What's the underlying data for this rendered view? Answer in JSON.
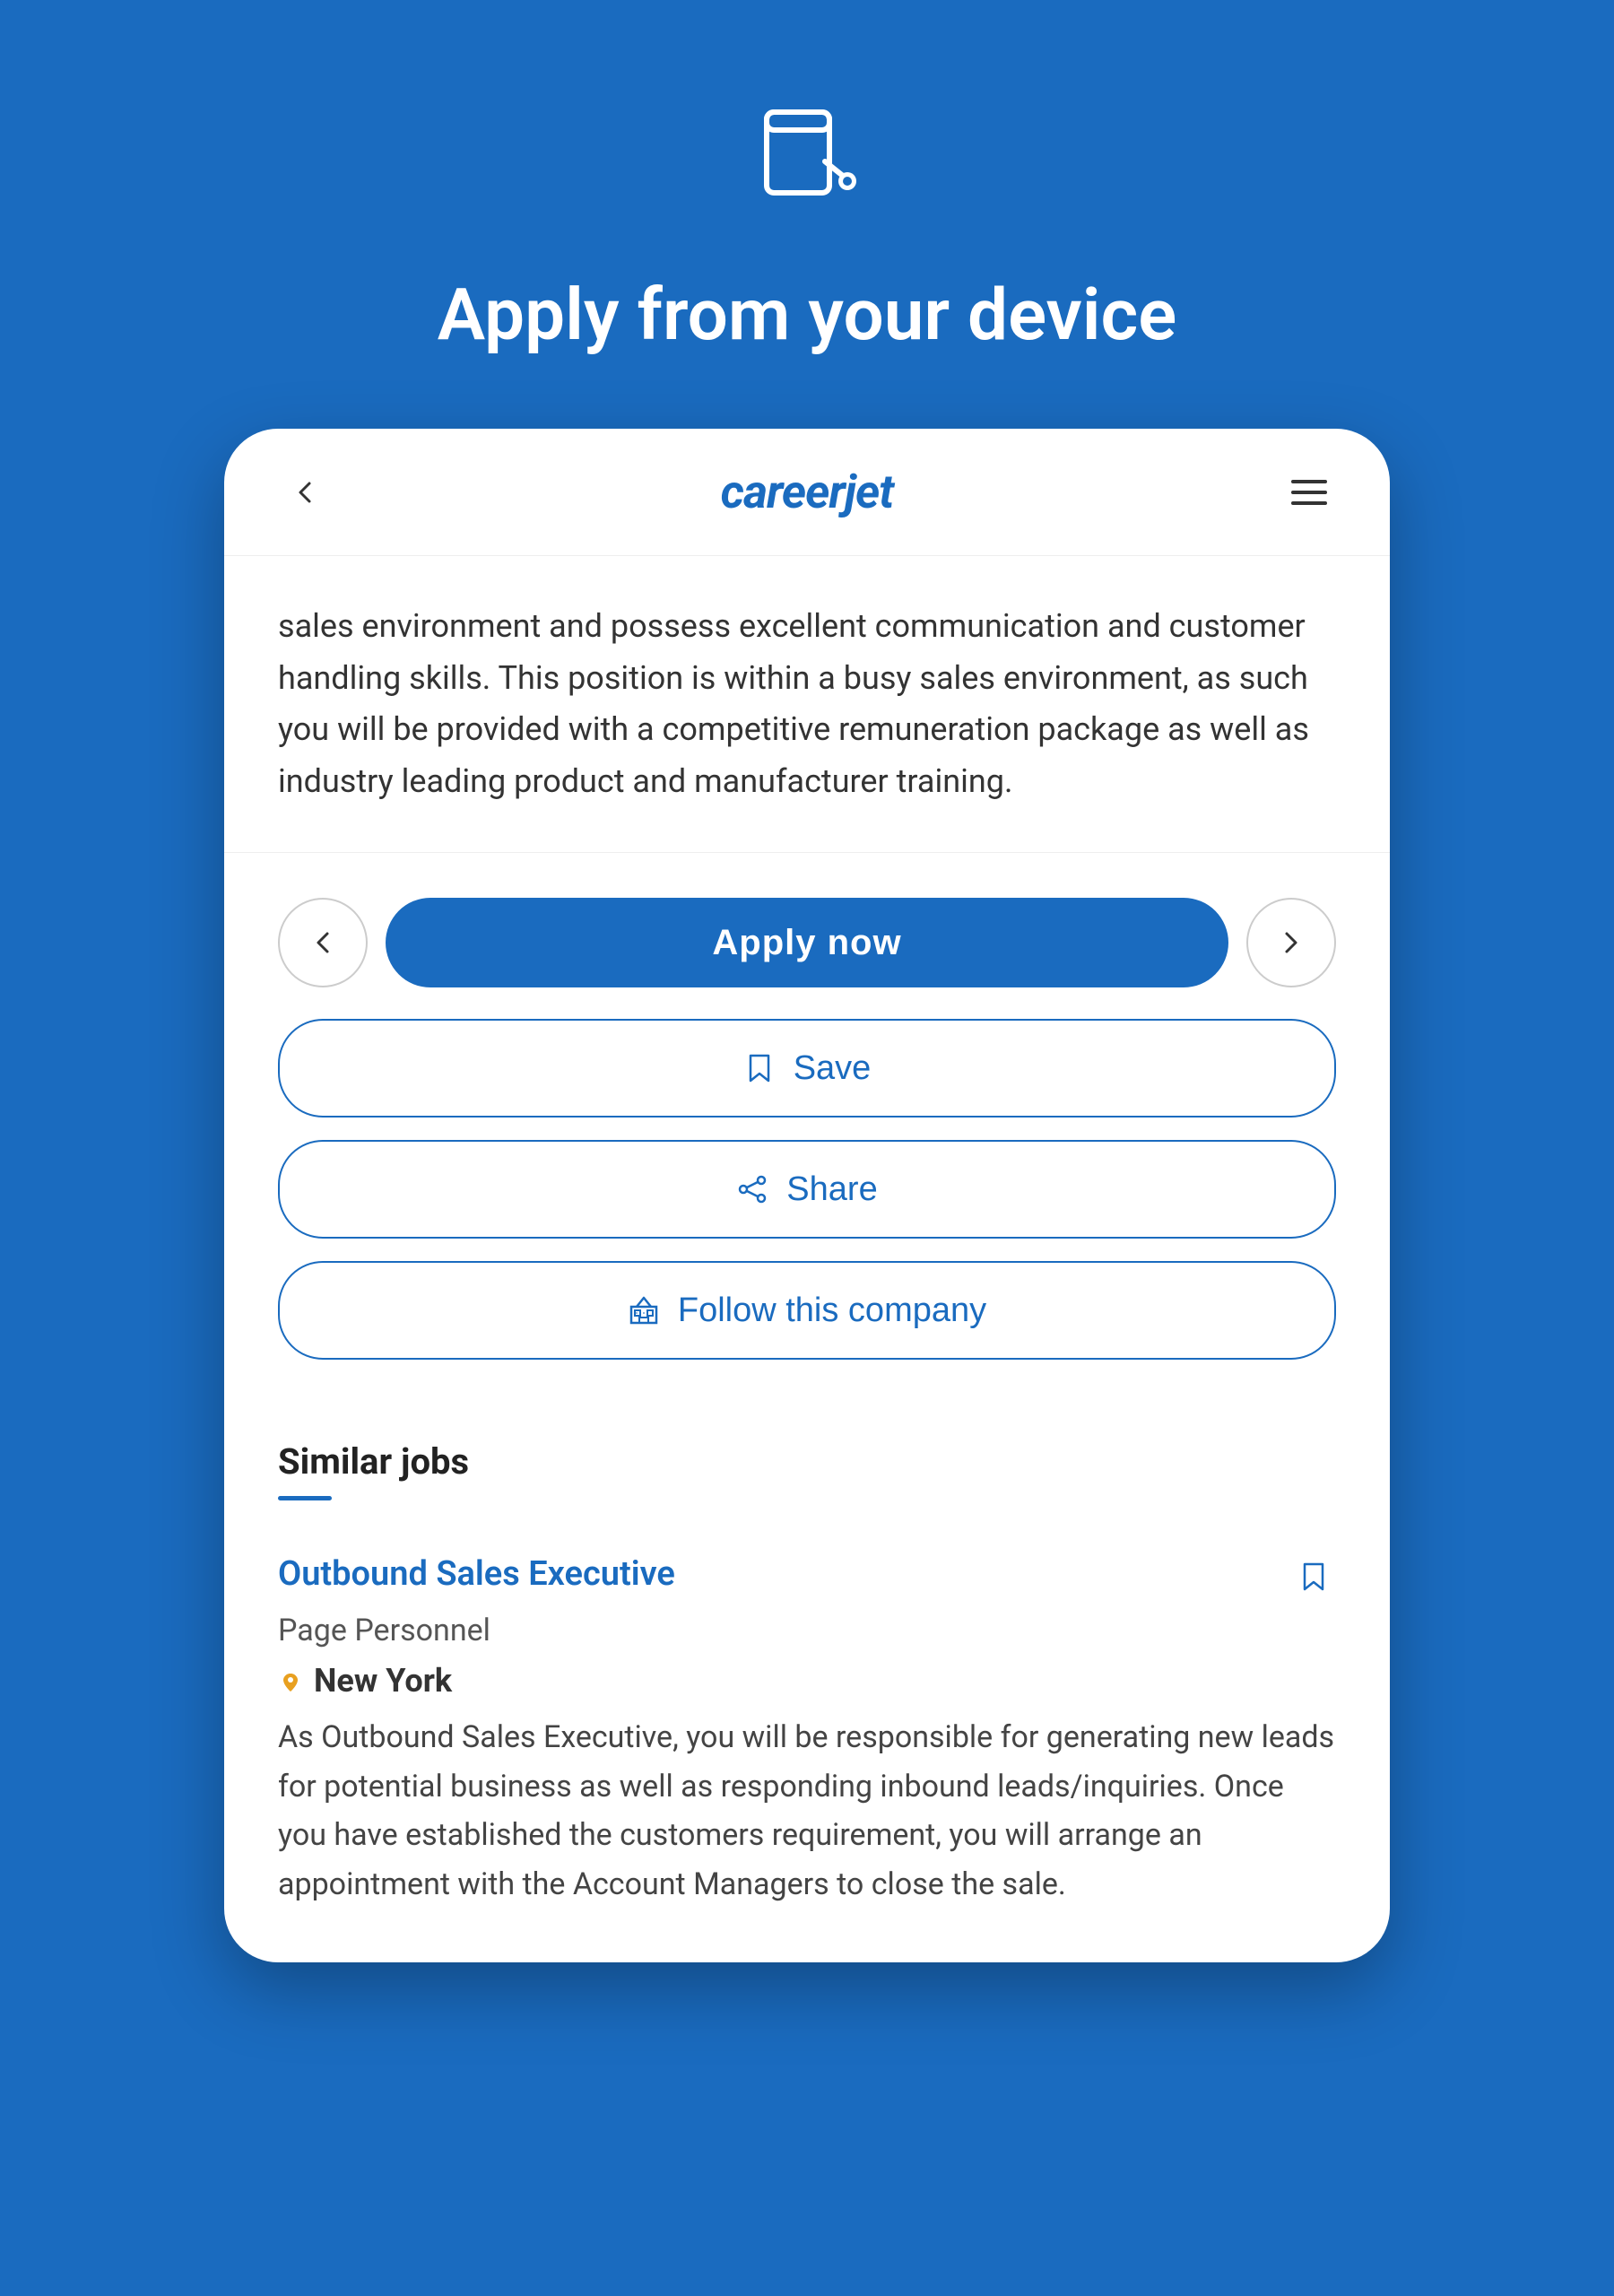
{
  "page": {
    "background_color": "#1a6bbf",
    "title": "Apply from your device"
  },
  "header": {
    "logo_text": "careerjet",
    "back_label": "‹",
    "menu_label": "☰"
  },
  "job_description_snippet": "sales environment and possess excellent communication and customer handling skills. This position is within a busy sales environment, as such you will be provided with a competitive remuneration package as well as industry leading product and manufacturer training.",
  "buttons": {
    "prev_label": "‹",
    "next_label": "›",
    "apply_label": "Apply now",
    "save_label": "Save",
    "share_label": "Share",
    "follow_label": "Follow this company"
  },
  "similar_jobs": {
    "section_title": "Similar jobs",
    "items": [
      {
        "title": "Outbound Sales Executive",
        "company": "Page Personnel",
        "location": "New York",
        "description": "As Outbound Sales Executive, you will be responsible for generating new leads for potential business as well as responding inbound leads/inquiries. Once you have established the customers requirement, you will arrange an appointment with the Account Managers to close the sale."
      }
    ]
  }
}
